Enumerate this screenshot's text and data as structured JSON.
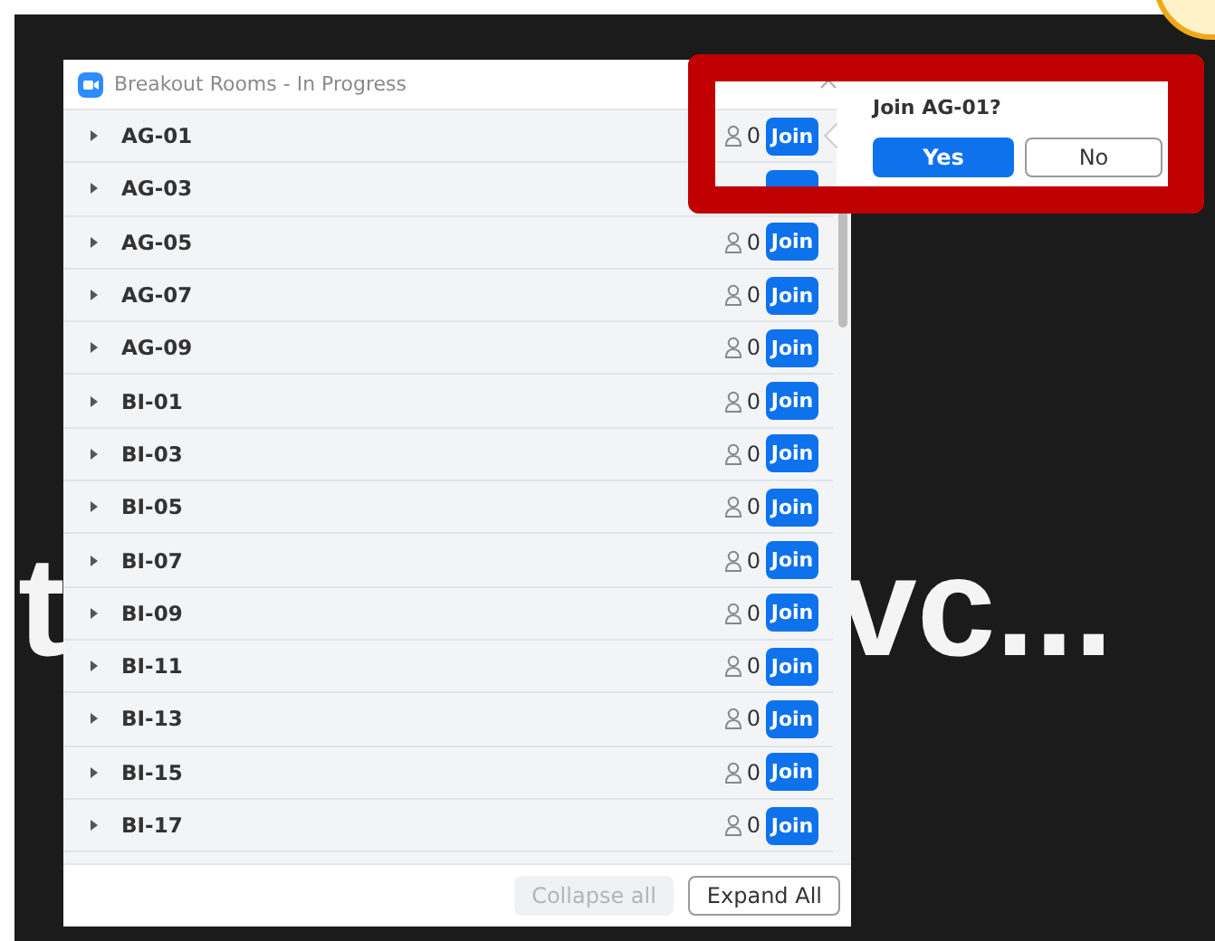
{
  "background_text": [
    "t",
    "vc..."
  ],
  "window": {
    "title": "Breakout Rooms - In Progress"
  },
  "rooms": [
    {
      "name": "AG-01",
      "count": "0",
      "action": "Join",
      "expanded": false
    },
    {
      "name": "AG-03",
      "expanded": false
    },
    {
      "name": "AG-05",
      "count": "0",
      "action": "Join",
      "expanded": false
    },
    {
      "name": "AG-07",
      "count": "0",
      "action": "Join",
      "expanded": false
    },
    {
      "name": "AG-09",
      "count": "0",
      "action": "Join",
      "expanded": false
    },
    {
      "name": "BI-01",
      "count": "0",
      "action": "Join",
      "expanded": false
    },
    {
      "name": "BI-03",
      "count": "0",
      "action": "Join",
      "expanded": false
    },
    {
      "name": "BI-05",
      "count": "0",
      "action": "Join",
      "expanded": false
    },
    {
      "name": "BI-07",
      "count": "0",
      "action": "Join",
      "expanded": false
    },
    {
      "name": "BI-09",
      "count": "0",
      "action": "Join",
      "expanded": false
    },
    {
      "name": "BI-11",
      "count": "0",
      "action": "Join",
      "expanded": false
    },
    {
      "name": "BI-13",
      "count": "0",
      "action": "Join",
      "expanded": false
    },
    {
      "name": "BI-15",
      "count": "0",
      "action": "Join",
      "expanded": false
    },
    {
      "name": "BI-17",
      "count": "0",
      "action": "Join",
      "expanded": false
    }
  ],
  "footer": [
    {
      "label": "Collapse all",
      "disabled": true
    },
    {
      "label": "Expand All",
      "disabled": false
    }
  ],
  "popup": {
    "question": "Join AG-01?",
    "yes": "Yes",
    "no": "No"
  }
}
